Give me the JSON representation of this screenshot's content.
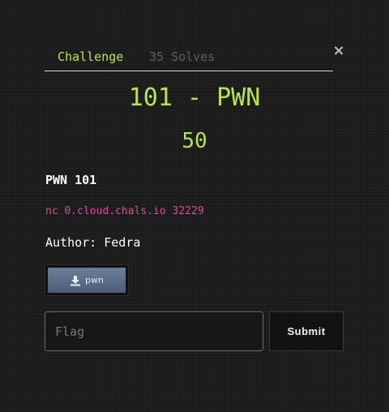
{
  "tabs": [
    {
      "label": "Challenge",
      "active": true
    },
    {
      "label": "35 Solves",
      "active": false
    }
  ],
  "close_icon": "close-icon",
  "challenge": {
    "title": "101 - PWN",
    "points": "50",
    "description_heading": "PWN 101",
    "connection": "nc 0.cloud.chals.io 32229",
    "author": "Author: Fedra"
  },
  "file": {
    "label": "pwn",
    "icon": "download-icon"
  },
  "flag": {
    "placeholder": "Flag",
    "value": ""
  },
  "submit_label": "Submit",
  "colors": {
    "accent": "#b6e64a",
    "connection_text": "#e7479a",
    "background": "#1d1d1d",
    "file_button": "#5a6d88"
  }
}
